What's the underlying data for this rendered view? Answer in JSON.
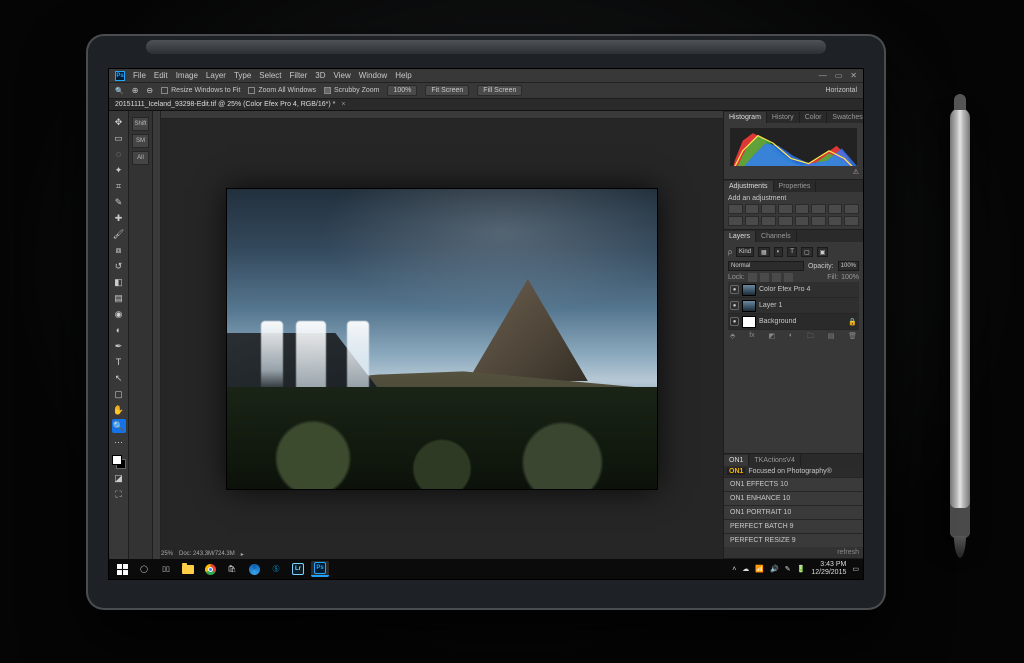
{
  "menubar": {
    "items": [
      "File",
      "Edit",
      "Image",
      "Layer",
      "Type",
      "Select",
      "Filter",
      "3D",
      "View",
      "Window",
      "Help"
    ]
  },
  "optionsbar": {
    "resize_label": "Resize Windows to Fit",
    "zoom_all_label": "Zoom All Windows",
    "scrubby_label": "Scrubby Zoom",
    "zoom_pct": "100%",
    "fit_label": "Fit Screen",
    "fill_label": "Fill Screen",
    "right_label": "Horizontal"
  },
  "document": {
    "tab_title": "20151111_Iceland_93298-Edit.tif @ 25% (Color Efex Pro 4, RGB/16*) *"
  },
  "sidebuttons": [
    "Shift",
    "SM",
    "All"
  ],
  "statusbar": {
    "zoom": "25%",
    "info": "Doc: 243.3M/724.3M"
  },
  "panels": {
    "histogram_tabs": [
      "Histogram",
      "History",
      "Color",
      "Swatches"
    ],
    "adjustments_tabs": [
      "Adjustments",
      "Properties"
    ],
    "adjustments_hint": "Add an adjustment",
    "layers_tabs": [
      "Layers",
      "Channels"
    ],
    "layer_filter": "Kind",
    "blend_mode": "Normal",
    "opacity_label": "Opacity:",
    "opacity_value": "100%",
    "lock_label": "Lock:",
    "fill_label": "Fill:",
    "fill_value": "100%",
    "layers": [
      {
        "name": "Color Efex Pro 4",
        "visible": true
      },
      {
        "name": "Layer 1",
        "visible": true
      },
      {
        "name": "Background",
        "visible": true,
        "locked": true
      }
    ],
    "plugin_tabs": [
      "ON1",
      "TKActionsV4"
    ],
    "plugin_tagline": "Focused on Photography®",
    "plugin_brand": "ON1",
    "plugins": [
      "ON1 EFFECTS 10",
      "ON1 ENHANCE 10",
      "ON1 PORTRAIT 10",
      "PERFECT BATCH 9",
      "PERFECT RESIZE 9"
    ],
    "refresh_label": "refresh"
  },
  "taskbar": {
    "time": "3:43 PM",
    "date": "12/29/2015"
  }
}
